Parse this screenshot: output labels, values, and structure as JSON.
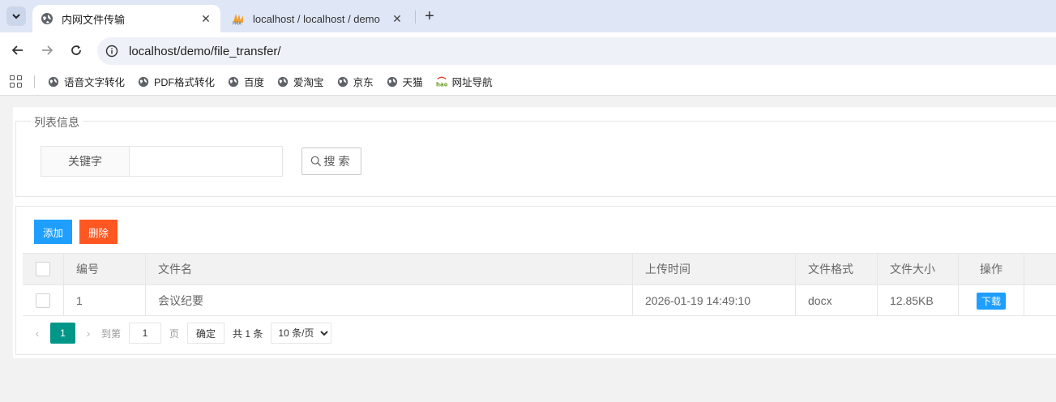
{
  "browser": {
    "tabs": [
      {
        "title": "内网文件传输",
        "active": true
      },
      {
        "title": "localhost / localhost / demo",
        "active": false
      }
    ],
    "tab_search_icon": "chevron-down-icon",
    "new_tab_icon": "plus-icon",
    "url": "localhost/demo/file_transfer/",
    "bookmarks": [
      {
        "label": "语音文字转化",
        "icon": "globe-icon"
      },
      {
        "label": "PDF格式转化",
        "icon": "globe-icon"
      },
      {
        "label": "百度",
        "icon": "globe-icon"
      },
      {
        "label": "爱淘宝",
        "icon": "globe-icon"
      },
      {
        "label": "京东",
        "icon": "globe-icon"
      },
      {
        "label": "天猫",
        "icon": "globe-icon"
      },
      {
        "label": "网址导航",
        "icon": "hao-icon"
      }
    ]
  },
  "search": {
    "legend": "列表信息",
    "keyword_label": "关键字",
    "keyword_value": "",
    "button_label": "搜索"
  },
  "actions": {
    "add_label": "添加",
    "delete_label": "删除"
  },
  "table": {
    "headers": [
      "编号",
      "文件名",
      "上传时间",
      "文件格式",
      "文件大小",
      "操作"
    ],
    "rows": [
      {
        "id": "1",
        "name": "会议纪要",
        "upload_time": "2026-01-19 14:49:10",
        "format": "docx",
        "size": "12.85KB",
        "action": "下载"
      }
    ]
  },
  "pagination": {
    "current_page": "1",
    "goto_label": "到第",
    "goto_value": "1",
    "page_unit": "页",
    "confirm_label": "确定",
    "total_label": "共 1 条",
    "page_size_selected": "10 条/页",
    "accent_color": "#009688"
  },
  "colors": {
    "primary_blue": "#1e9fff",
    "danger_orange": "#ff5722"
  }
}
